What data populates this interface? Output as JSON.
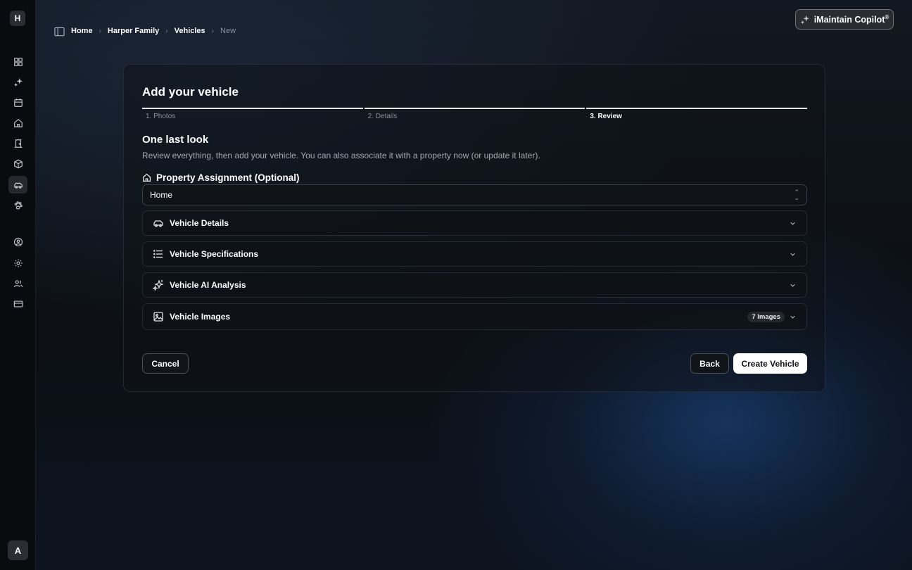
{
  "app": {
    "logo_letter": "H",
    "user_initial": "A"
  },
  "sidebar": {
    "items": [
      {
        "icon": "dashboard-icon"
      },
      {
        "icon": "sparkles-icon"
      },
      {
        "icon": "calendar-icon"
      },
      {
        "icon": "home-icon"
      },
      {
        "icon": "door-icon"
      },
      {
        "icon": "box-icon"
      },
      {
        "icon": "car-icon",
        "active": true
      },
      {
        "icon": "paw-icon"
      },
      {
        "icon": "user-circle-icon"
      },
      {
        "icon": "gear-icon"
      },
      {
        "icon": "users-icon"
      },
      {
        "icon": "credit-card-icon"
      }
    ]
  },
  "breadcrumb": {
    "items": [
      "Home",
      "Harper Family",
      "Vehicles",
      "New"
    ]
  },
  "copilot": {
    "label": "iMaintain Copilot",
    "mark": "®"
  },
  "form": {
    "title": "Add your vehicle",
    "steps": [
      "1. Photos",
      "2. Details",
      "3. Review"
    ],
    "current_step": 3,
    "section_title": "One last look",
    "section_desc": "Review everything, then add your vehicle. You can also associate it with a property now (or update it later).",
    "property": {
      "label": "Property Assignment (Optional)",
      "value": "Home"
    },
    "accordions": [
      {
        "label": "Vehicle Details",
        "icon": "car-icon"
      },
      {
        "label": "Vehicle Specifications",
        "icon": "list-icon"
      },
      {
        "label": "Vehicle AI Analysis",
        "icon": "sparkles-icon"
      },
      {
        "label": "Vehicle Images",
        "icon": "image-icon",
        "badge": "7 Images"
      }
    ],
    "buttons": {
      "cancel": "Cancel",
      "back": "Back",
      "create": "Create Vehicle"
    }
  },
  "colors": {
    "accent_glow": "#1e5096",
    "primary_button": "#ffffff"
  }
}
